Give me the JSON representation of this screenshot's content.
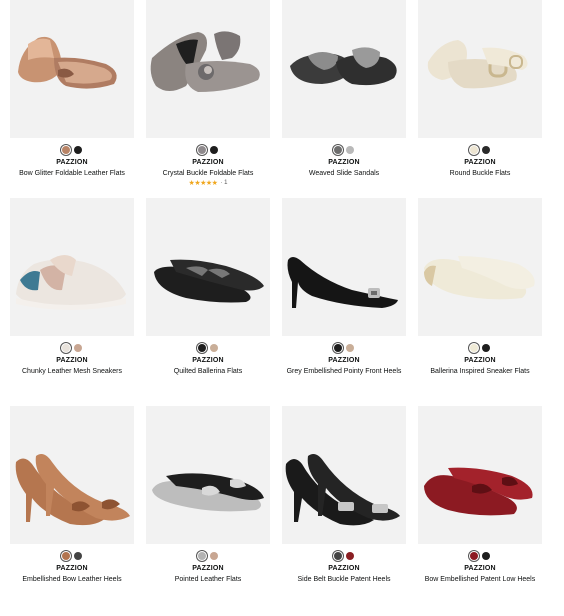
{
  "products": [
    {
      "brand": "PAZZION",
      "title": "Bow Glitter Foldable Leather Flats",
      "swatches": [
        "#b98466",
        "#1e1e1e"
      ],
      "selected": 0
    },
    {
      "brand": "PAZZION",
      "title": "Crystal Buckle Foldable Flats",
      "swatches": [
        "#8f8a8d",
        "#1e1e1e"
      ],
      "selected": 0,
      "rating": {
        "stars": "★★★★★",
        "count": "1"
      }
    },
    {
      "brand": "PAZZION",
      "title": "Weaved Slide Sandals",
      "swatches": [
        "#6e6e6e",
        "#b9b9b9"
      ],
      "selected": 0
    },
    {
      "brand": "PAZZION",
      "title": "Round Buckle Flats",
      "swatches": [
        "#ede5d2",
        "#2a2a2a"
      ],
      "selected": 0
    },
    {
      "brand": "PAZZION",
      "title": "Chunky Leather Mesh Sneakers",
      "swatches": [
        "#e9e3dc",
        "#c8a692"
      ],
      "selected": 0
    },
    {
      "brand": "PAZZION",
      "title": "Quilted Ballerina Flats",
      "swatches": [
        "#1e1e1e",
        "#c9ae98"
      ],
      "selected": 0
    },
    {
      "brand": "PAZZION",
      "title": "Grey Embellished Pointy Front Heels",
      "swatches": [
        "#1e1e1e",
        "#c9ae98"
      ],
      "selected": 0
    },
    {
      "brand": "PAZZION",
      "title": "Ballerina Inspired Sneaker Flats",
      "swatches": [
        "#efead6",
        "#1e1e1e"
      ],
      "selected": 0
    },
    {
      "brand": "PAZZION",
      "title": "Embellished Bow Leather Heels",
      "swatches": [
        "#b2744f",
        "#444444"
      ],
      "selected": 0
    },
    {
      "brand": "PAZZION",
      "title": "Pointed Leather Flats",
      "swatches": [
        "#b3b3b3",
        "#c8a692"
      ],
      "selected": 0
    },
    {
      "brand": "PAZZION",
      "title": "Side Belt Buckle Patent Heels",
      "swatches": [
        "#444444",
        "#8a1f23"
      ],
      "selected": 0
    },
    {
      "brand": "PAZZION",
      "title": "Bow Embellished Patent Low Heels",
      "swatches": [
        "#8c1a22",
        "#1e1e1e"
      ],
      "selected": 0
    }
  ]
}
